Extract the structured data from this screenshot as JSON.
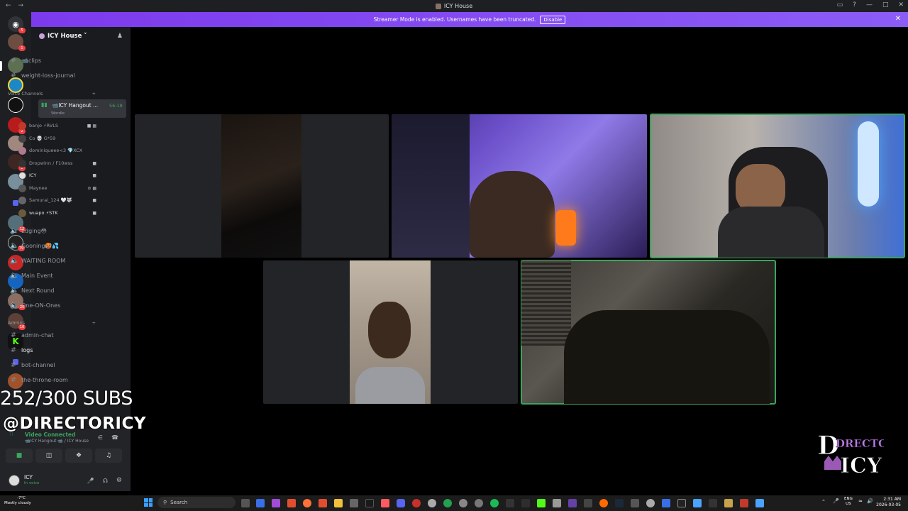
{
  "window": {
    "title": "ICY House"
  },
  "banner": {
    "text": "Streamer Mode is enabled. Usernames have been truncated.",
    "button": "Disable"
  },
  "guild": {
    "name": "ICY House ˅"
  },
  "text_channels_top": [
    "📹clips",
    "weight-loss-journal"
  ],
  "voice_category": "Voice Channels",
  "active_voice": {
    "name": "📹ICY Hangout ...",
    "timer": "56:18",
    "activity": "Wordle"
  },
  "voice_users": [
    {
      "name": "banjo ⚡RVLS",
      "color": "#c0392b"
    },
    {
      "name": "Co 💀 G*59",
      "color": "#444"
    },
    {
      "name": "dominiqueee<3 💎XCX",
      "color": "#b07a8c"
    },
    {
      "name": "Dropwinn / F10wss",
      "color": "#333"
    },
    {
      "name": "ICY",
      "color": "#e0e0e0"
    },
    {
      "name": "Maynee",
      "color": "#555"
    },
    {
      "name": "Samurai_124 🤍🐺",
      "color": "#666"
    },
    {
      "name": "wuapo ⚡STK",
      "color": "#6b5b3e"
    }
  ],
  "voice_channels": [
    "Edging😳",
    "Gooning🥵💦",
    "WAITING ROOM",
    "Main Event",
    "Next Round",
    "One-ON-Ones"
  ],
  "admin_category": "Admins",
  "admin_channels": [
    "admin-chat",
    "logs",
    "bot-channel",
    "the-throne-room"
  ],
  "overlay": {
    "subs": "252/300 SUBS",
    "handle": "@DIRECTORICY"
  },
  "voice_panel": {
    "status": "Video Connected",
    "location": "📹ICY Hangout 📹 / ICY House"
  },
  "user": {
    "name": "ICY",
    "status": "In voice"
  },
  "taskbar": {
    "search": "Search",
    "weather_temp": "-7°C",
    "weather_desc": "Mostly cloudy",
    "lang1": "ENG",
    "lang2": "US",
    "time": "2:31 AM",
    "date": "2026-03-05"
  },
  "logo_text": {
    "top": "DRECTOR",
    "bottom": "ICY"
  }
}
